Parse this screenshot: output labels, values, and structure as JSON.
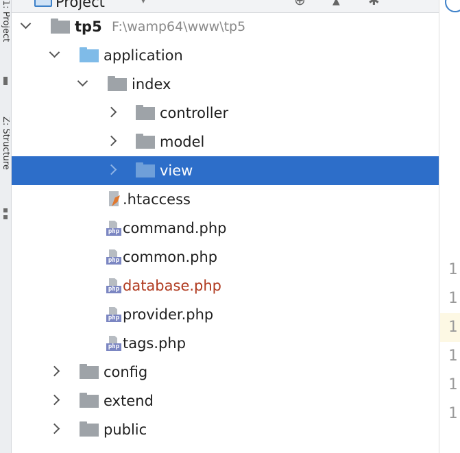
{
  "header": {
    "title": "Project"
  },
  "side_strip": {
    "top_label": "1: Project",
    "bottom_label": "Z: Structure"
  },
  "tree": {
    "rows": [
      {
        "label": "tp5",
        "path": "F:\\wamp64\\www\\tp5",
        "kind": "folder",
        "color": "gray",
        "expanded": true,
        "depth": 0
      },
      {
        "label": "application",
        "kind": "folder",
        "color": "blue",
        "expanded": true,
        "depth": 1
      },
      {
        "label": "index",
        "kind": "folder",
        "color": "gray",
        "expanded": true,
        "depth": 2
      },
      {
        "label": "controller",
        "kind": "folder",
        "color": "gray",
        "expanded": false,
        "depth": 3
      },
      {
        "label": "model",
        "kind": "folder",
        "color": "gray",
        "expanded": false,
        "depth": 3
      },
      {
        "label": "view",
        "kind": "folder",
        "color": "gray",
        "expanded": false,
        "depth": 3,
        "selected": true
      },
      {
        "label": ".htaccess",
        "kind": "htaccess",
        "depth": 3
      },
      {
        "label": "command.php",
        "kind": "php",
        "depth": 3
      },
      {
        "label": "common.php",
        "kind": "php",
        "depth": 3
      },
      {
        "label": "database.php",
        "kind": "php",
        "depth": 3,
        "modified": true,
        "text_color": "#b03a1f"
      },
      {
        "label": "provider.php",
        "kind": "php",
        "depth": 3
      },
      {
        "label": "tags.php",
        "kind": "php",
        "depth": 3
      },
      {
        "label": "config",
        "kind": "folder",
        "color": "gray",
        "expanded": false,
        "depth": 1
      },
      {
        "label": "extend",
        "kind": "folder",
        "color": "gray",
        "expanded": false,
        "depth": 1
      },
      {
        "label": "public",
        "kind": "folder",
        "color": "gray",
        "expanded": false,
        "depth": 1
      }
    ]
  },
  "php_icon_text": "php",
  "gutter": {
    "line_numbers": [
      "1",
      "1",
      "1",
      "1",
      "1",
      "1"
    ]
  },
  "colors": {
    "selection": "#2d6ec9",
    "folder_blue": "#7fbbe8",
    "folder_gray": "#9ea3a8",
    "modified_text": "#b03a1f"
  }
}
